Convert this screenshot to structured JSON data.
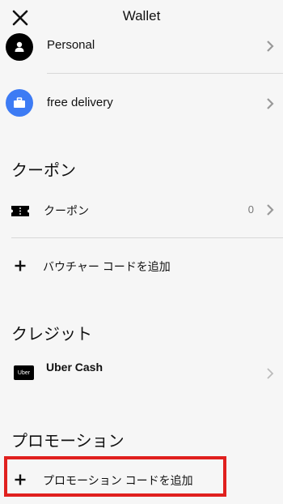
{
  "header": {
    "title": "Wallet",
    "close_icon": "close-icon"
  },
  "profiles": [
    {
      "label": "Personal",
      "icon": "person-icon",
      "icon_color": "#000000"
    },
    {
      "label": "free delivery",
      "icon": "briefcase-icon",
      "icon_color": "#3d7bf4"
    }
  ],
  "coupons": {
    "section_title": "クーポン",
    "row_label": "クーポン",
    "count": "0",
    "icon": "ticket-icon",
    "add_label": "バウチャー コードを追加"
  },
  "credits": {
    "section_title": "クレジット",
    "row_label": "Uber Cash",
    "logo_text": "Uber"
  },
  "promotions": {
    "section_title": "プロモーション",
    "add_label": "プロモーション コードを追加",
    "highlight_color": "#e0201e"
  }
}
